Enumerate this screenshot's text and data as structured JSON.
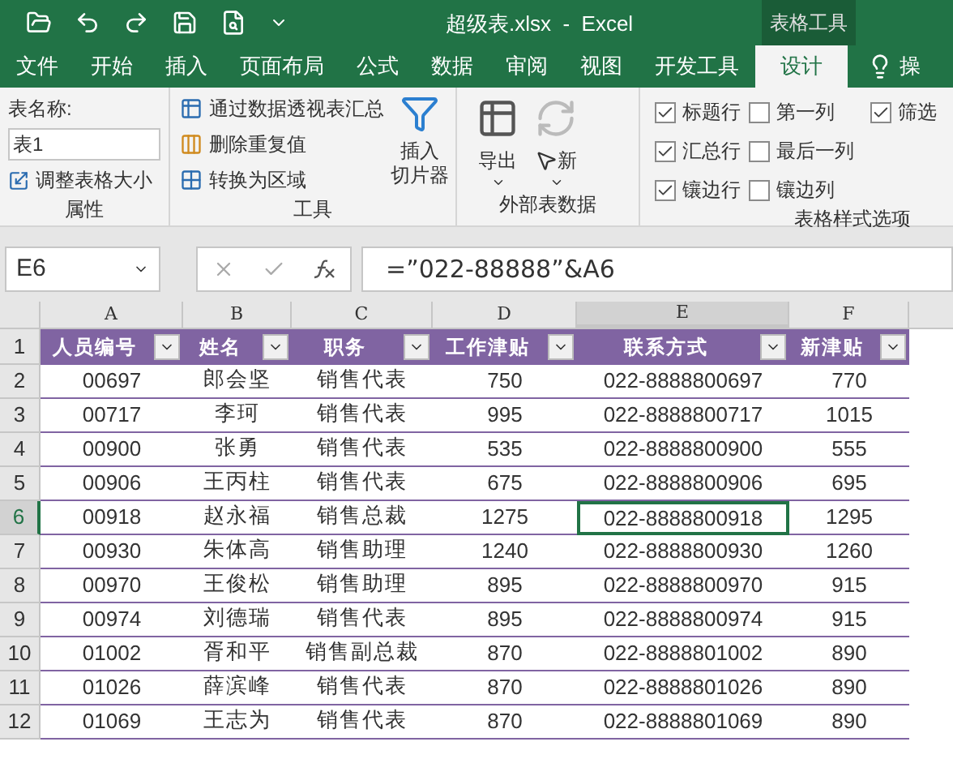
{
  "window": {
    "title": "超级表.xlsx  -  Excel",
    "context_tab": "表格工具"
  },
  "tabs": [
    {
      "label": "文件",
      "selected": false
    },
    {
      "label": "开始",
      "selected": false
    },
    {
      "label": "插入",
      "selected": false
    },
    {
      "label": "页面布局",
      "selected": false
    },
    {
      "label": "公式",
      "selected": false
    },
    {
      "label": "数据",
      "selected": false
    },
    {
      "label": "审阅",
      "selected": false
    },
    {
      "label": "视图",
      "selected": false
    },
    {
      "label": "开发工具",
      "selected": false
    },
    {
      "label": "设计",
      "selected": true
    }
  ],
  "tell_me": "操",
  "ribbon": {
    "properties": {
      "name_label": "表名称:",
      "name_value": "表1",
      "resize": "调整表格大小",
      "group": "属性"
    },
    "tools": {
      "items": [
        "通过数据透视表汇总",
        "删除重复值",
        "转换为区域"
      ],
      "slicer": [
        "插入",
        "切片器"
      ],
      "group": "工具"
    },
    "external": {
      "export": "导出",
      "refresh": "新",
      "group": "外部表数据"
    },
    "style_options": {
      "options": [
        {
          "label": "标题行",
          "checked": true
        },
        {
          "label": "汇总行",
          "checked": true
        },
        {
          "label": "镶边行",
          "checked": true
        },
        {
          "label": "第一列",
          "checked": false
        },
        {
          "label": "最后一列",
          "checked": false
        },
        {
          "label": "镶边列",
          "checked": false
        },
        {
          "label": "筛选",
          "checked": true
        }
      ],
      "group": "表格样式选项"
    }
  },
  "formula_bar": {
    "name_box": "E6",
    "formula": "=”022-88888”&A6"
  },
  "sheet": {
    "columns": [
      {
        "letter": "A",
        "selected": false
      },
      {
        "letter": "B",
        "selected": false
      },
      {
        "letter": "C",
        "selected": false
      },
      {
        "letter": "D",
        "selected": false
      },
      {
        "letter": "E",
        "selected": true
      },
      {
        "letter": "F",
        "selected": false
      }
    ],
    "header_row": "1",
    "headers": [
      "人员编号",
      "姓名",
      "职务",
      "工作津贴",
      "联系方式",
      "新津贴"
    ],
    "rows": [
      {
        "number": "2",
        "selected": false,
        "cells": [
          "00697",
          "郎会坚",
          "销售代表",
          "750",
          "022-8888800697",
          "770"
        ]
      },
      {
        "number": "3",
        "selected": false,
        "cells": [
          "00717",
          "李珂",
          "销售代表",
          "995",
          "022-8888800717",
          "1015"
        ]
      },
      {
        "number": "4",
        "selected": false,
        "cells": [
          "00900",
          "张勇",
          "销售代表",
          "535",
          "022-8888800900",
          "555"
        ]
      },
      {
        "number": "5",
        "selected": false,
        "cells": [
          "00906",
          "王丙柱",
          "销售代表",
          "675",
          "022-8888800906",
          "695"
        ]
      },
      {
        "number": "6",
        "selected": true,
        "cells": [
          "00918",
          "赵永福",
          "销售总裁",
          "1275",
          "022-8888800918",
          "1295"
        ]
      },
      {
        "number": "7",
        "selected": false,
        "cells": [
          "00930",
          "朱体高",
          "销售助理",
          "1240",
          "022-8888800930",
          "1260"
        ]
      },
      {
        "number": "8",
        "selected": false,
        "cells": [
          "00970",
          "王俊松",
          "销售助理",
          "895",
          "022-8888800970",
          "915"
        ]
      },
      {
        "number": "9",
        "selected": false,
        "cells": [
          "00974",
          "刘德瑞",
          "销售代表",
          "895",
          "022-8888800974",
          "915"
        ]
      },
      {
        "number": "10",
        "selected": false,
        "cells": [
          "01002",
          "胥和平",
          "销售副总裁",
          "870",
          "022-8888801002",
          "890"
        ]
      },
      {
        "number": "11",
        "selected": false,
        "cells": [
          "01026",
          "薛滨峰",
          "销售代表",
          "870",
          "022-8888801026",
          "890"
        ]
      },
      {
        "number": "12",
        "selected": false,
        "cells": [
          "01069",
          "王志为",
          "销售代表",
          "870",
          "022-8888801069",
          "890"
        ]
      }
    ]
  }
}
